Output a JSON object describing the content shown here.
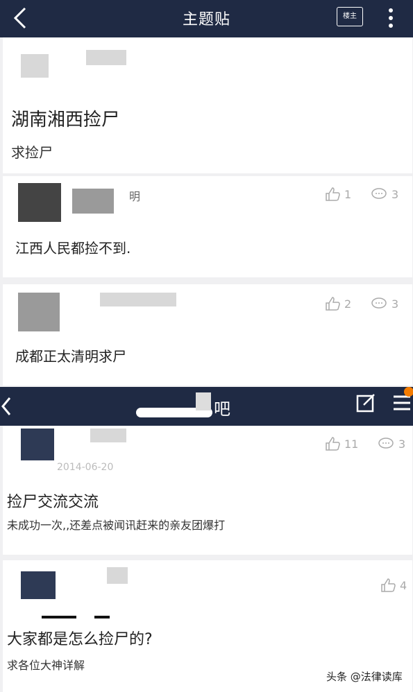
{
  "top_bar": {
    "title": "主题贴",
    "louzhu_label": "楼主"
  },
  "post": {
    "title": "湖南湘西捡尸",
    "body": "求捡尸"
  },
  "replies": [
    {
      "username_fragment": "明",
      "text": "江西人民都捡不到.",
      "likes": "1",
      "comments": "3"
    },
    {
      "text": "成都正太清明求尸",
      "likes": "2",
      "comments": "3"
    }
  ],
  "second_bar": {
    "title": "吧"
  },
  "threads": [
    {
      "date": "2014-06-20",
      "title": "捡尸交流交流",
      "body": "未成功一次,,还差点被闻讯赶来的亲友团爆打",
      "likes": "11",
      "comments": "3"
    },
    {
      "title": "大家都是怎么捡尸的?",
      "body": "求各位大神详解",
      "likes": "4"
    }
  ],
  "watermark": "头条 @法律读库"
}
